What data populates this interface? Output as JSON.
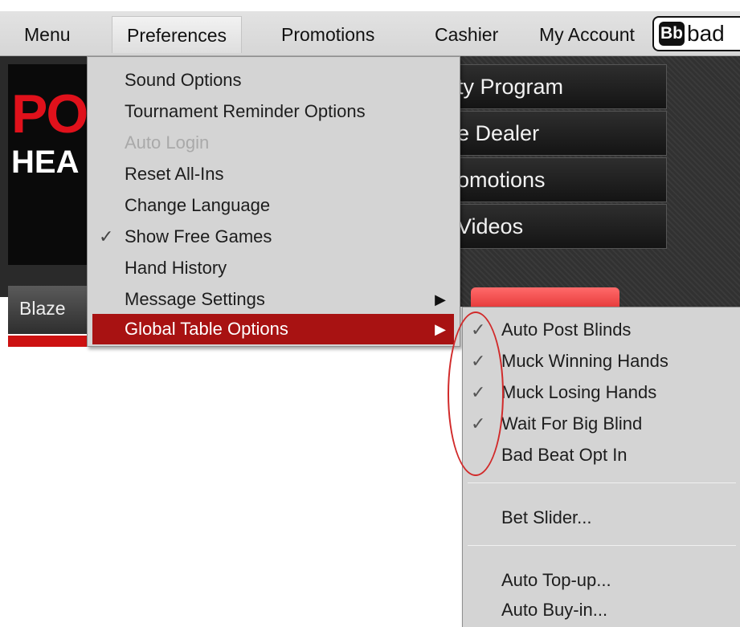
{
  "menubar": {
    "items": [
      {
        "label": "Menu"
      },
      {
        "label": "Preferences"
      },
      {
        "label": "Promotions"
      },
      {
        "label": "Cashier"
      },
      {
        "label": "My Account"
      }
    ],
    "logo_mark": "Bb",
    "logo_text": "bad"
  },
  "banner": {
    "title_red": "PO",
    "title_white": "HEA"
  },
  "lobby_buttons": [
    "ty Program",
    "e Dealer",
    "omotions",
    "Videos"
  ],
  "tab_label": "Blaze",
  "preferences_menu": {
    "items": [
      {
        "label": "Sound Options"
      },
      {
        "label": "Tournament Reminder Options"
      },
      {
        "label": "Auto Login"
      },
      {
        "label": "Reset All-Ins"
      },
      {
        "label": "Change Language"
      },
      {
        "label": "Show Free Games"
      },
      {
        "label": "Hand History"
      },
      {
        "label": "Message Settings"
      },
      {
        "label": "Global Table Options"
      }
    ]
  },
  "global_table_menu": {
    "items": [
      {
        "label": "Auto Post Blinds"
      },
      {
        "label": "Muck Winning Hands"
      },
      {
        "label": "Muck Losing Hands"
      },
      {
        "label": "Wait For Big Blind"
      },
      {
        "label": "Bad Beat Opt In"
      },
      {
        "label": "Bet Slider..."
      },
      {
        "label": "Auto Top-up..."
      },
      {
        "label": "Auto Buy-in..."
      }
    ]
  },
  "colors": {
    "highlight": "#a81212",
    "annotation": "#d12a2a",
    "brand_red": "#e0111b"
  },
  "glyphs": {
    "check": "✓",
    "submenu_arrow": "▶"
  }
}
